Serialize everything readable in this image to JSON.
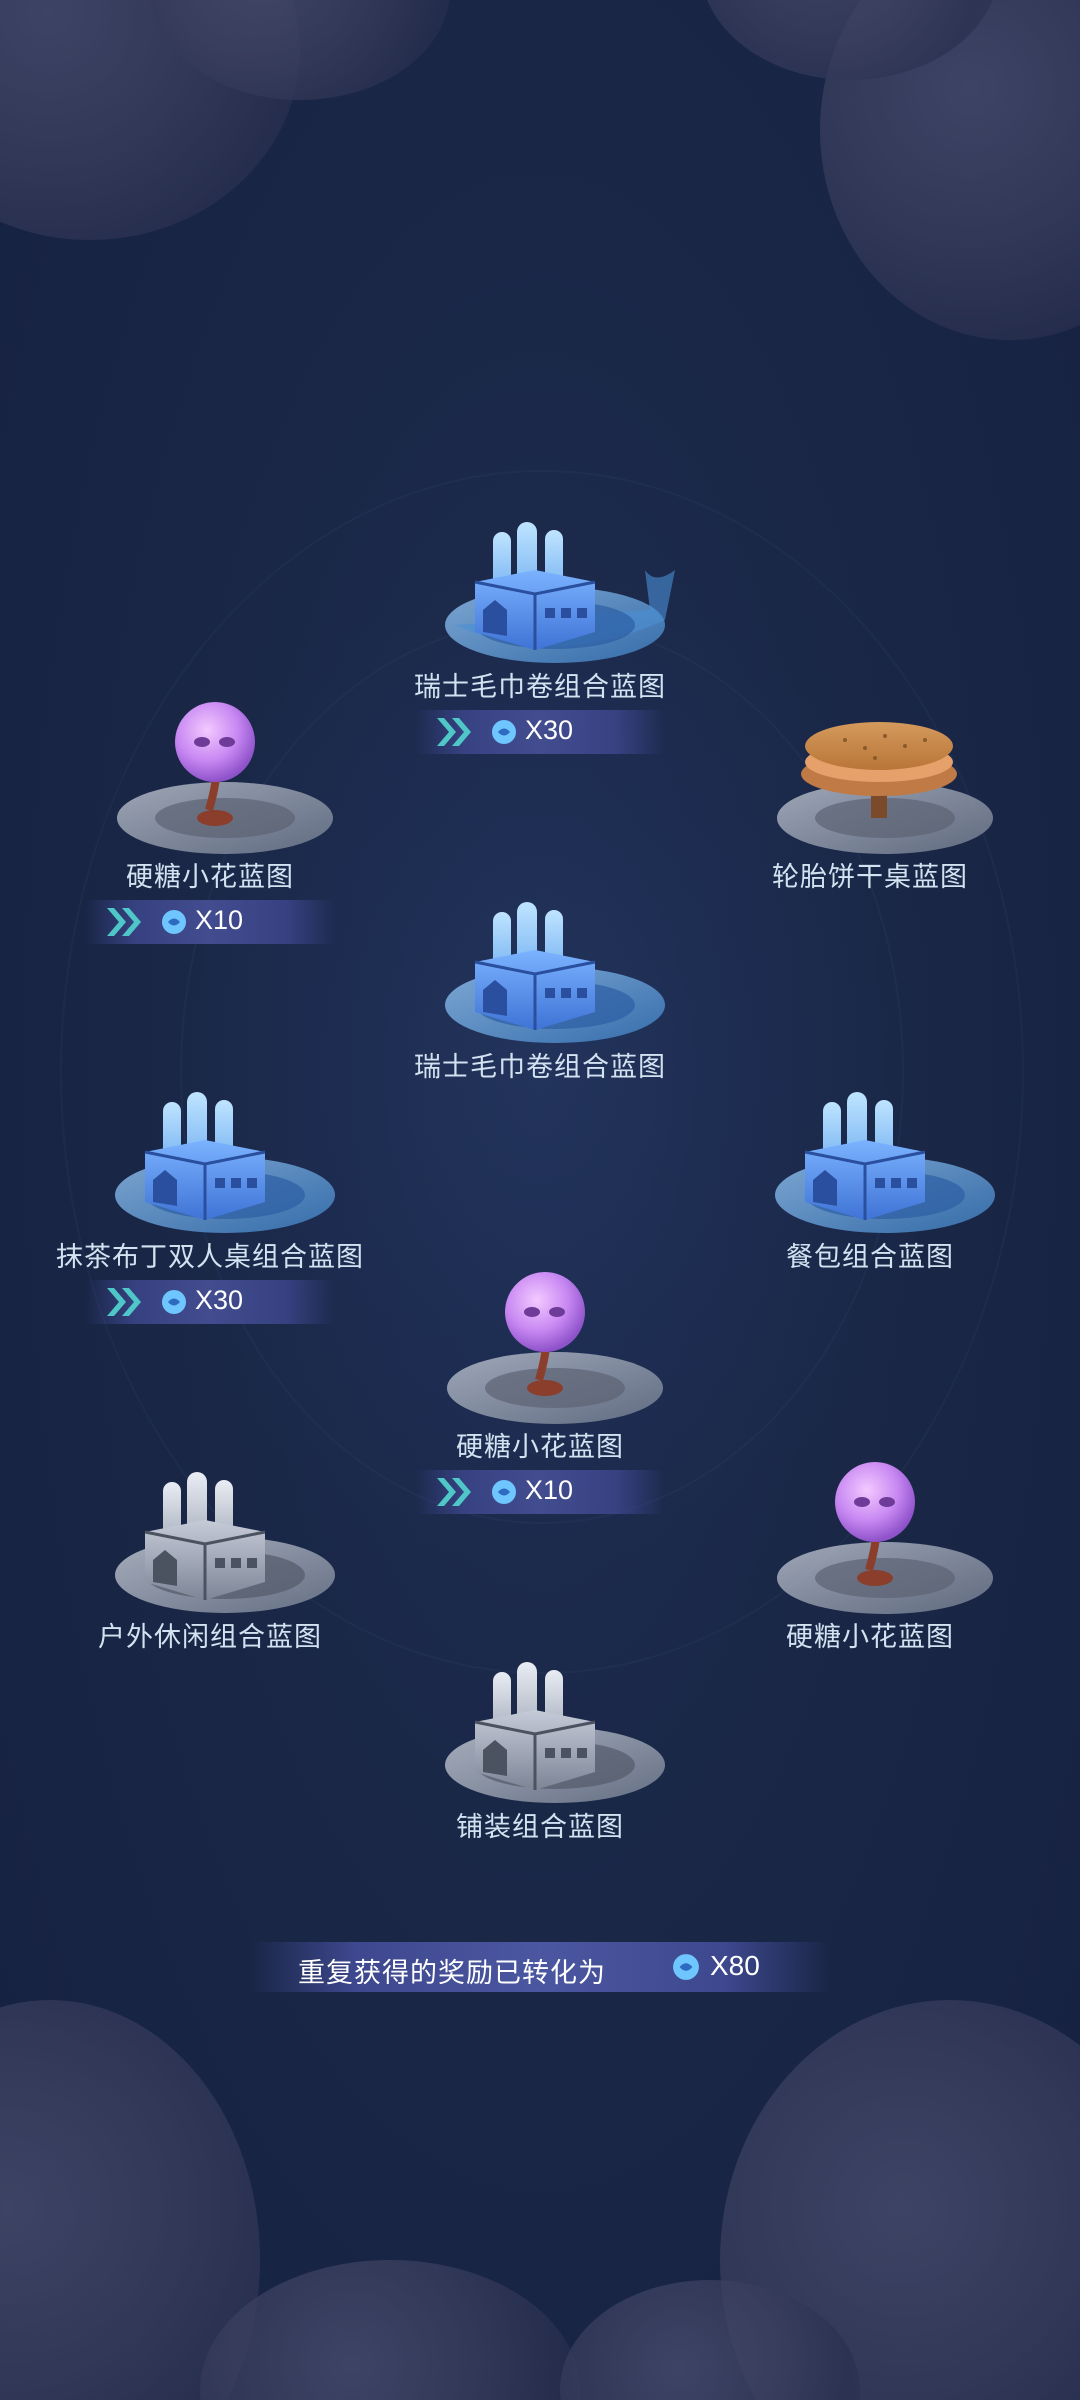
{
  "rewards": [
    {
      "label": "瑞士毛巾卷组合蓝图",
      "bonus": "X30",
      "icon": "blue-house-icon"
    },
    {
      "label": "硬糖小花蓝图",
      "bonus": "X10",
      "icon": "candy-flower-icon"
    },
    {
      "label": "轮胎饼干桌蓝图",
      "bonus": "",
      "icon": "cookie-table-icon"
    },
    {
      "label": "瑞士毛巾卷组合蓝图",
      "bonus": "",
      "icon": "blue-house-icon"
    },
    {
      "label": "抹茶布丁双人桌组合蓝图",
      "bonus": "X30",
      "icon": "blue-house-icon"
    },
    {
      "label": "餐包组合蓝图",
      "bonus": "",
      "icon": "blue-house-icon"
    },
    {
      "label": "硬糖小花蓝图",
      "bonus": "X10",
      "icon": "candy-flower-icon"
    },
    {
      "label": "户外休闲组合蓝图",
      "bonus": "",
      "icon": "gray-house-icon"
    },
    {
      "label": "硬糖小花蓝图",
      "bonus": "",
      "icon": "candy-flower-icon"
    },
    {
      "label": "铺装组合蓝图",
      "bonus": "",
      "icon": "gray-house-icon"
    }
  ],
  "footer": {
    "message": "重复获得的奖励已转化为",
    "total": "X80",
    "currency_icon": "blue-gem-icon"
  },
  "colors": {
    "background": "#1a2747",
    "label": "#d3e2f0",
    "bonus_bar": "#464f96",
    "arrow": "#4fc7c9",
    "gem": "#6fc6ff"
  }
}
